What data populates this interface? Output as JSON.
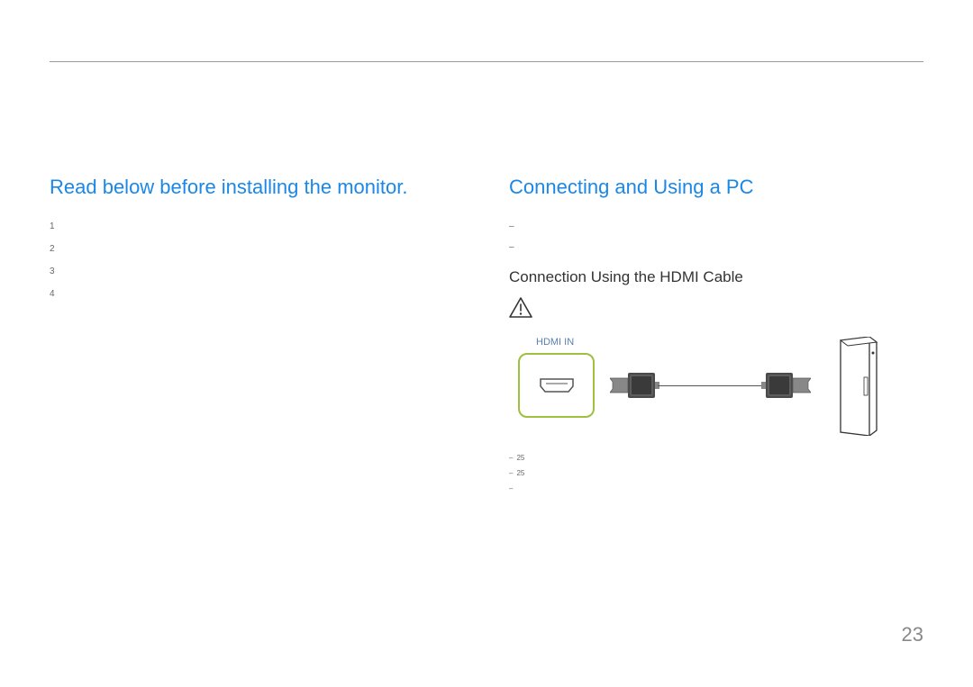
{
  "page_number": "23",
  "left": {
    "heading": "Read below before installing the monitor.",
    "items": [
      "1",
      "2",
      "3",
      "4"
    ]
  },
  "right": {
    "heading": "Connecting and Using a PC",
    "dashes": [
      "",
      ""
    ],
    "subheading": "Connection Using the HDMI Cable",
    "port_label": "HDMI IN",
    "footnote_lines": [
      "25",
      "25",
      ""
    ]
  }
}
